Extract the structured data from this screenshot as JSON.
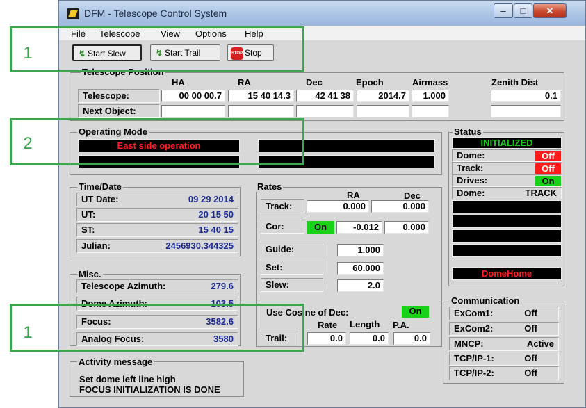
{
  "window": {
    "title": "DFM - Telescope Control System"
  },
  "menu": [
    "File",
    "Telescope",
    "View",
    "Options",
    "Help"
  ],
  "toolbar": {
    "start_slew": "Start Slew",
    "start_trail": "Start Trail",
    "stop": "Stop",
    "stop_icon_text": "STOP"
  },
  "position": {
    "group_label": "Telescope Position",
    "headers": [
      "HA",
      "RA",
      "Dec",
      "Epoch",
      "Airmass",
      "Zenith Dist"
    ],
    "telescope_label": "Telescope:",
    "telescope": [
      "00 00 00.7",
      "15 40 14.3",
      "42 41 38",
      "2014.7",
      "1.000",
      "0.1"
    ],
    "next_label": "Next Object:",
    "next": [
      "",
      "",
      "",
      "",
      "",
      ""
    ]
  },
  "operating_mode": {
    "label": "Operating Mode",
    "east_side": "East side operation"
  },
  "status": {
    "label": "Status",
    "state": "INITIALIZED",
    "dome_label": "Dome:",
    "dome_value": "Off",
    "track_label": "Track:",
    "track_value": "Off",
    "drives_label": "Drives:",
    "drives_value": "On",
    "dome2_label": "Dome:",
    "dome2_value": "TRACK",
    "dome_home": "DomeHome"
  },
  "time_date": {
    "label": "Time/Date",
    "rows": [
      {
        "label": "UT Date:",
        "value": "09 29 2014"
      },
      {
        "label": "UT:",
        "value": "20 15 50"
      },
      {
        "label": "ST:",
        "value": "15 40 15"
      },
      {
        "label": "Julian:",
        "value": "2456930.344325"
      }
    ]
  },
  "misc": {
    "label": "Misc.",
    "rows": [
      {
        "label": "Telescope Azimuth:",
        "value": "279.6"
      },
      {
        "label": "Dome Azimuth:",
        "value": "103.5"
      },
      {
        "label": "Focus:",
        "value": "3582.6"
      },
      {
        "label": "Analog Focus:",
        "value": "3580"
      }
    ]
  },
  "rates": {
    "label": "Rates",
    "ra_header": "RA",
    "dec_header": "Dec",
    "track_label": "Track:",
    "track_ra": "0.000",
    "track_dec": "0.000",
    "cor_label": "Cor:",
    "cor_state": "On",
    "cor_ra": "-0.012",
    "cor_dec": "0.000",
    "guide_label": "Guide:",
    "guide": "1.000",
    "set_label": "Set:",
    "set": "60.000",
    "slew_label": "Slew:",
    "slew": "2.0",
    "cosine_label": "Use Cosine of Dec:",
    "cosine_state": "On",
    "trail_rate_header": "Rate",
    "trail_length_header": "Length",
    "trail_pa_header": "P.A.",
    "trail_label": "Trail:",
    "trail_rate": "0.0",
    "trail_length": "0.0",
    "trail_pa": "0.0"
  },
  "communication": {
    "label": "Communication",
    "rows": [
      {
        "label": "ExCom1:",
        "value": "Off"
      },
      {
        "label": "ExCom2:",
        "value": "Off"
      },
      {
        "label": "MNCP:",
        "value": "Active"
      },
      {
        "label": "TCP/IP-1:",
        "value": "Off"
      },
      {
        "label": "TCP/IP-2:",
        "value": "Off"
      }
    ]
  },
  "activity": {
    "label": "Activity message",
    "line1": "Set dome left line high",
    "line2": "FOCUS INITIALIZATION IS DONE"
  },
  "annotations": [
    "1",
    "2",
    "1"
  ],
  "colors": {
    "annotation_green": "#3ba64b",
    "status_green": "#1ad11a",
    "status_red": "#ff1a1a"
  }
}
